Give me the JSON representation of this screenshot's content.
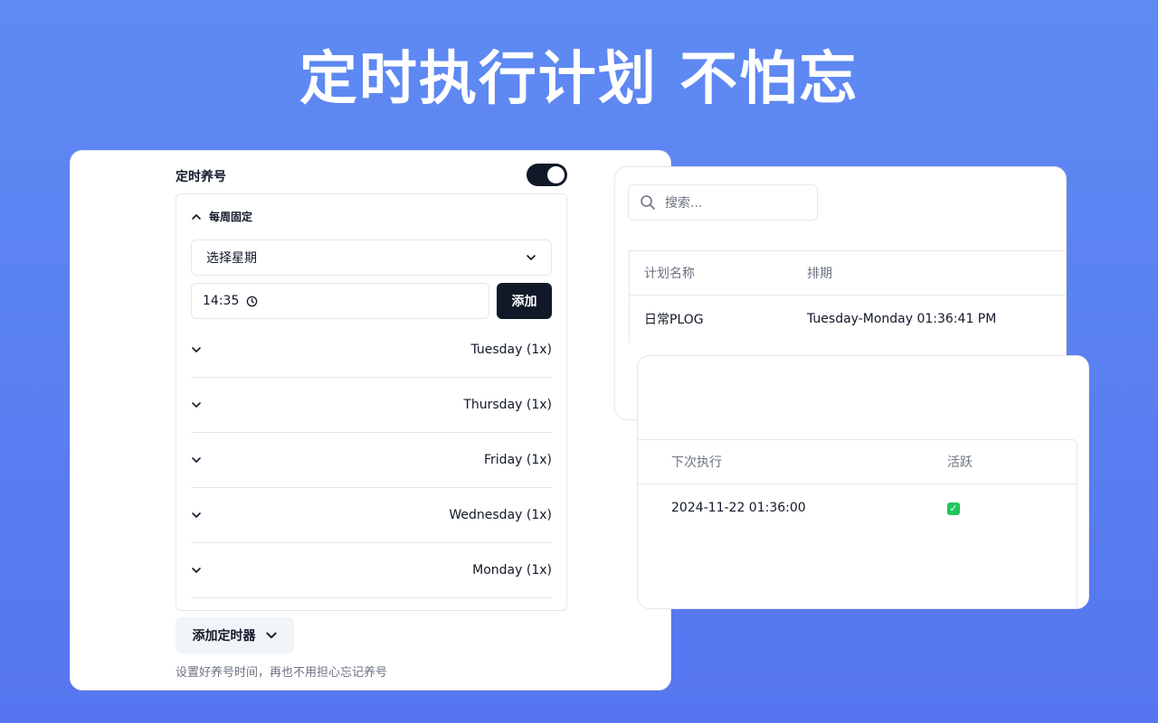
{
  "headline": "定时执行计划 不怕忘",
  "scheduler": {
    "title": "定时养号",
    "toggle_on": true,
    "section_label": "每周固定",
    "weekday_select": {
      "value": "选择星期"
    },
    "time_input": {
      "value": "14:35"
    },
    "add_label": "添加",
    "days": [
      {
        "label": "Tuesday (1x)"
      },
      {
        "label": "Thursday (1x)"
      },
      {
        "label": "Friday (1x)"
      },
      {
        "label": "Wednesday (1x)"
      },
      {
        "label": "Monday (1x)"
      }
    ],
    "add_timer_label": "添加定时器",
    "hint": "设置好养号时间，再也不用担心忘记养号"
  },
  "plans": {
    "search_placeholder": "搜索...",
    "columns": [
      "计划名称",
      "排期"
    ],
    "rows": [
      {
        "name": "日常PLOG",
        "schedule": "Tuesday-Monday 01:36:41 PM"
      }
    ]
  },
  "runs": {
    "columns": [
      "下次执行",
      "活跃"
    ],
    "rows": [
      {
        "next": "2024-11-22 01:36:00",
        "active": true
      }
    ]
  },
  "colors": {
    "accent": "#111827",
    "background": "#5b80f1",
    "active": "#22c55e"
  },
  "icons": [
    "chevron-up-icon",
    "chevron-down-icon",
    "clock-icon",
    "search-icon",
    "check-icon"
  ]
}
